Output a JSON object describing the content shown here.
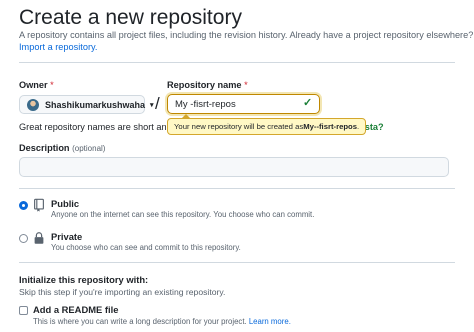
{
  "header": {
    "title": "Create a new repository",
    "intro": "A repository contains all project files, including the revision history. Already have a project repository elsewhere?",
    "import_link": "Import a repository."
  },
  "owner": {
    "label": "Owner",
    "required_mark": "*",
    "selected": "Shashikumarkushwaha",
    "caret": "▾"
  },
  "separator": "/",
  "repo_name": {
    "label": "Repository name",
    "required_mark": "*",
    "value": "My -fisrt-repos",
    "valid_mark": "✓"
  },
  "name_hint": {
    "text_before": "Great repository names are short and m",
    "text_after": "fiesta?"
  },
  "tooltip": {
    "prefix": "Your new repository will be created as ",
    "name": "My--fisrt-repos",
    "suffix": "."
  },
  "description": {
    "label": "Description",
    "optional": "(optional)",
    "value": ""
  },
  "visibility": {
    "options": [
      {
        "title": "Public",
        "desc": "Anyone on the internet can see this repository. You choose who can commit.",
        "icon": "repo-icon",
        "selected": true
      },
      {
        "title": "Private",
        "desc": "You choose who can see and commit to this repository.",
        "icon": "lock-icon",
        "selected": false
      }
    ]
  },
  "initialize": {
    "title": "Initialize this repository with:",
    "desc": "Skip this step if you're importing an existing repository.",
    "readme": {
      "label": "Add a README file",
      "desc": "This is where you can write a long description for your project.",
      "link": "Learn more.",
      "checked": false
    }
  },
  "colors": {
    "link": "#0969da",
    "success": "#1a7f37",
    "required": "#d1242f",
    "warning_border": "#bf8700",
    "tooltip_bg": "#fff8c5"
  }
}
